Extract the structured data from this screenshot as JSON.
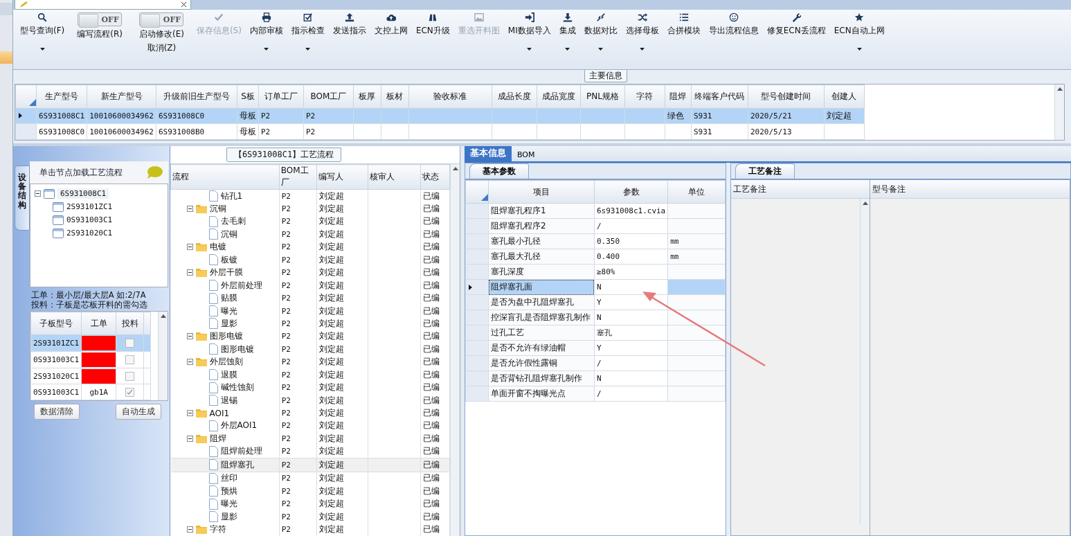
{
  "toolbar": [
    {
      "kind": "button",
      "label": "型号查询(F)",
      "disabled": false,
      "dropdown": true
    },
    {
      "kind": "toggle",
      "toggle_text": "OFF",
      "on": false,
      "label": "编写流程(R)"
    },
    {
      "kind": "toggle",
      "toggle_text": "OFF",
      "on": false,
      "label": "启动修改(E)",
      "sublabel": "取消(Z)"
    },
    {
      "kind": "button",
      "label": "保存信息(S)",
      "disabled": true,
      "dropdown": false
    },
    {
      "kind": "button",
      "label": "内部审核",
      "disabled": false,
      "dropdown": true
    },
    {
      "kind": "button",
      "label": "指示检查",
      "disabled": false,
      "dropdown": true
    },
    {
      "kind": "button",
      "label": "发送指示",
      "disabled": false,
      "dropdown": false
    },
    {
      "kind": "button",
      "label": "文控上网",
      "disabled": false,
      "dropdown": false
    },
    {
      "kind": "button",
      "label": "ECN升级",
      "disabled": false,
      "dropdown": false
    },
    {
      "kind": "button",
      "label": "重选开料图",
      "disabled": true,
      "dropdown": false
    },
    {
      "kind": "button",
      "label": "MI数据导入",
      "disabled": false,
      "dropdown": true
    },
    {
      "kind": "button",
      "label": "集成",
      "disabled": false,
      "dropdown": true
    },
    {
      "kind": "button",
      "label": "数据对比",
      "disabled": false,
      "dropdown": true
    },
    {
      "kind": "button",
      "label": "选择母板",
      "disabled": false,
      "dropdown": true
    },
    {
      "kind": "button",
      "label": "合拼模块",
      "disabled": false,
      "dropdown": false
    },
    {
      "kind": "button",
      "label": "导出流程信息",
      "disabled": false,
      "dropdown": false
    },
    {
      "kind": "button",
      "label": "修复ECN丢流程",
      "disabled": false,
      "dropdown": false
    },
    {
      "kind": "button",
      "label": "ECN自动上网",
      "disabled": false,
      "dropdown": true
    }
  ],
  "main_info": {
    "title": "主要信息",
    "table": {
      "columns": [
        "生产型号",
        "新生产型号",
        "升级前旧生产型号",
        "S板",
        "订单工厂",
        "BOM工厂",
        "板厚",
        "板材",
        "验收标准",
        "成品长度",
        "成品宽度",
        "PNL规格",
        "字符",
        "阻焊",
        "终端客户代码",
        "型号创建时间",
        "创建人"
      ],
      "rows": [
        {
          "selected": true,
          "cells": [
            "6S931008C1",
            "10010600034962",
            "6S931008C0",
            "母板",
            "P2",
            "P2",
            null,
            null,
            null,
            null,
            null,
            null,
            null,
            "绿色",
            "S931",
            "2020/5/21",
            "刘定超"
          ]
        },
        {
          "selected": false,
          "cells": [
            "6S931008C0",
            "10010600034962",
            "6S931008B0",
            "母板",
            "P2",
            "P2",
            null,
            null,
            null,
            null,
            null,
            null,
            null,
            null,
            "S931",
            "2020/5/13",
            null
          ]
        }
      ]
    }
  },
  "structure_panel": {
    "side_tab": "设备结构",
    "hint": "单击节点加载工艺流程",
    "tree": [
      {
        "label": "6S931008C1",
        "expanded": true,
        "children": [
          {
            "label": "2S93101ZC1"
          },
          {
            "label": "0S931003C1"
          },
          {
            "label": "2S931020C1"
          }
        ]
      }
    ],
    "notes": [
      "工单：最小层/最大层A 如:2/7A",
      "投料：子板是芯板开料的需勾选"
    ],
    "table": {
      "columns": [
        "子板型号",
        "工单",
        "投料"
      ],
      "rows": [
        {
          "model": "2S93101ZC1",
          "color": "#ff0000",
          "checked": false,
          "selected": true
        },
        {
          "model": "0S931003C1",
          "color": "#ff0000",
          "checked": false,
          "selected": false
        },
        {
          "model": "2S931020C1",
          "color": "#ff0000",
          "checked": false,
          "selected": false
        },
        {
          "model": "0S931003C1",
          "order": "gb1A",
          "checked": true,
          "selected": false
        }
      ]
    },
    "buttons": [
      "数据清除",
      "自动生成"
    ]
  },
  "flow_panel": {
    "title": "【6S931008C1】工艺流程",
    "columns": [
      "流程",
      "BOM工厂",
      "编写人",
      "核审人",
      "状态"
    ],
    "rows": [
      {
        "name": "钻孔1",
        "bom": "P2",
        "writer": "刘定超",
        "status": "已编",
        "selected": false
      },
      {
        "name": "沉铜",
        "bom": "P2",
        "writer": "刘定超",
        "status": "已编",
        "selected": false,
        "expanded": true,
        "children": [
          {
            "name": "去毛刺",
            "bom": "P2",
            "writer": "刘定超",
            "status": "已编",
            "selected": false
          },
          {
            "name": "沉铜",
            "bom": "P2",
            "writer": "刘定超",
            "status": "已编",
            "selected": false
          }
        ]
      },
      {
        "name": "电镀",
        "bom": "P2",
        "writer": "刘定超",
        "status": "已编",
        "selected": false,
        "expanded": true,
        "children": [
          {
            "name": "板镀",
            "bom": "P2",
            "writer": "刘定超",
            "status": "已编",
            "selected": false
          }
        ]
      },
      {
        "name": "外层干膜",
        "bom": "P2",
        "writer": "刘定超",
        "status": "已编",
        "selected": false,
        "expanded": true,
        "children": [
          {
            "name": "外层前处理",
            "bom": "P2",
            "writer": "刘定超",
            "status": "已编",
            "selected": false
          },
          {
            "name": "贴膜",
            "bom": "P2",
            "writer": "刘定超",
            "status": "已编",
            "selected": false
          },
          {
            "name": "曝光",
            "bom": "P2",
            "writer": "刘定超",
            "status": "已编",
            "selected": false
          },
          {
            "name": "显影",
            "bom": "P2",
            "writer": "刘定超",
            "status": "已编",
            "selected": false
          }
        ]
      },
      {
        "name": "图形电镀",
        "bom": "P2",
        "writer": "刘定超",
        "status": "已编",
        "selected": false,
        "expanded": true,
        "children": [
          {
            "name": "图形电镀",
            "bom": "P2",
            "writer": "刘定超",
            "status": "已编",
            "selected": false
          }
        ]
      },
      {
        "name": "外层蚀刻",
        "bom": "P2",
        "writer": "刘定超",
        "status": "已编",
        "selected": false,
        "expanded": true,
        "children": [
          {
            "name": "退膜",
            "bom": "P2",
            "writer": "刘定超",
            "status": "已编",
            "selected": false
          },
          {
            "name": "碱性蚀刻",
            "bom": "P2",
            "writer": "刘定超",
            "status": "已编",
            "selected": false
          },
          {
            "name": "退锡",
            "bom": "P2",
            "writer": "刘定超",
            "status": "已编",
            "selected": false
          }
        ]
      },
      {
        "name": "AOI1",
        "bom": "P2",
        "writer": "刘定超",
        "status": "已编",
        "selected": false,
        "expanded": true,
        "children": [
          {
            "name": "外层AOI1",
            "bom": "P2",
            "writer": "刘定超",
            "status": "已编",
            "selected": false
          }
        ]
      },
      {
        "name": "阻焊",
        "bom": "P2",
        "writer": "刘定超",
        "status": "已编",
        "selected": false,
        "expanded": true,
        "children": [
          {
            "name": "阻焊前处理",
            "bom": "P2",
            "writer": "刘定超",
            "status": "已编",
            "selected": false
          },
          {
            "name": "阻焊塞孔",
            "bom": "P2",
            "writer": "刘定超",
            "status": "已编",
            "selected": true
          },
          {
            "name": "丝印",
            "bom": "P2",
            "writer": "刘定超",
            "status": "已编",
            "selected": false
          },
          {
            "name": "预烘",
            "bom": "P2",
            "writer": "刘定超",
            "status": "已编",
            "selected": false
          },
          {
            "name": "曝光",
            "bom": "P2",
            "writer": "刘定超",
            "status": "已编",
            "selected": false
          },
          {
            "name": "显影",
            "bom": "P2",
            "writer": "刘定超",
            "status": "已编",
            "selected": false
          }
        ]
      },
      {
        "name": "字符",
        "bom": "P2",
        "writer": "刘定超",
        "status": "已编",
        "selected": false,
        "expanded": true
      }
    ]
  },
  "detail_panel": {
    "tabs": [
      {
        "label": "基本信息",
        "selected": true
      },
      {
        "label": "BOM",
        "selected": false
      }
    ],
    "params": {
      "tab": "基本参数",
      "columns": [
        "项目",
        "参数",
        "单位"
      ],
      "rows": [
        {
          "item": "阻焊塞孔程序1",
          "value": "6s931008c1.cvia",
          "selected": false
        },
        {
          "item": "阻焊塞孔程序2",
          "value": "/",
          "selected": false
        },
        {
          "item": "塞孔最小孔径",
          "value": "0.350",
          "unit": "mm",
          "selected": false
        },
        {
          "item": "塞孔最大孔径",
          "value": "0.400",
          "unit": "mm",
          "selected": false
        },
        {
          "item": "塞孔深度",
          "value": "≥80%",
          "selected": false
        },
        {
          "item": "阻焊塞孔面",
          "value": "N",
          "selected": true
        },
        {
          "item": "是否为盘中孔阻焊塞孔",
          "value": "Y",
          "selected": false
        },
        {
          "item": "控深盲孔是否阻焊塞孔制作",
          "value": "N",
          "selected": false
        },
        {
          "item": "过孔工艺",
          "value": "塞孔",
          "selected": false
        },
        {
          "item": "是否不允许有绿油帽",
          "value": "Y",
          "selected": false
        },
        {
          "item": "是否允许假性露铜",
          "value": "/",
          "selected": false
        },
        {
          "item": "是否背钻孔阻焊塞孔制作",
          "value": "N",
          "selected": false
        },
        {
          "item": "单面开窗不掏曝光点",
          "value": "/",
          "selected": false
        }
      ]
    },
    "remarks": {
      "tab": "工艺备注",
      "columns": [
        "工艺备注",
        "型号备注"
      ]
    }
  }
}
